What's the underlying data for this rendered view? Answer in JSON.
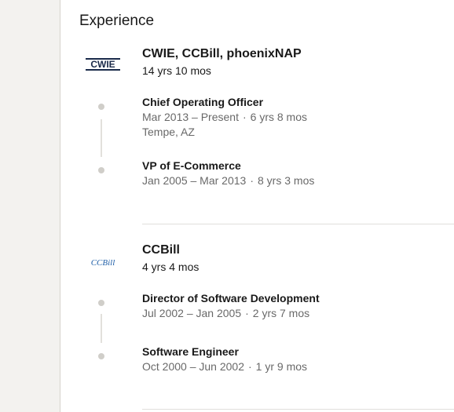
{
  "section": {
    "title": "Experience"
  },
  "companies": [
    {
      "logo_text": "CWIE",
      "name": "CWIE, CCBill, phoenixNAP",
      "duration": "14 yrs 10 mos",
      "roles": [
        {
          "title": "Chief Operating Officer",
          "date_range": "Mar 2013 – Present",
          "length": "6 yrs 8 mos",
          "location": "Tempe, AZ"
        },
        {
          "title": "VP of E-Commerce",
          "date_range": "Jan 2005 – Mar 2013",
          "length": "8 yrs 3 mos"
        }
      ]
    },
    {
      "logo_text": "CCBill",
      "name": "CCBill",
      "duration": "4 yrs 4 mos",
      "roles": [
        {
          "title": "Director of Software Development",
          "date_range": "Jul 2002 – Jan 2005",
          "length": "2 yrs 7 mos"
        },
        {
          "title": "Software Engineer",
          "date_range": "Oct 2000 – Jun 2002",
          "length": "1 yr 9 mos"
        }
      ]
    }
  ],
  "separator": "·",
  "colors": {
    "page_bg": "#f3f2ef",
    "card_bg": "#ffffff",
    "timeline": "#d0cec9",
    "cwie_logo": "#1a2a4a",
    "ccbill_logo": "#1f5fa8"
  }
}
